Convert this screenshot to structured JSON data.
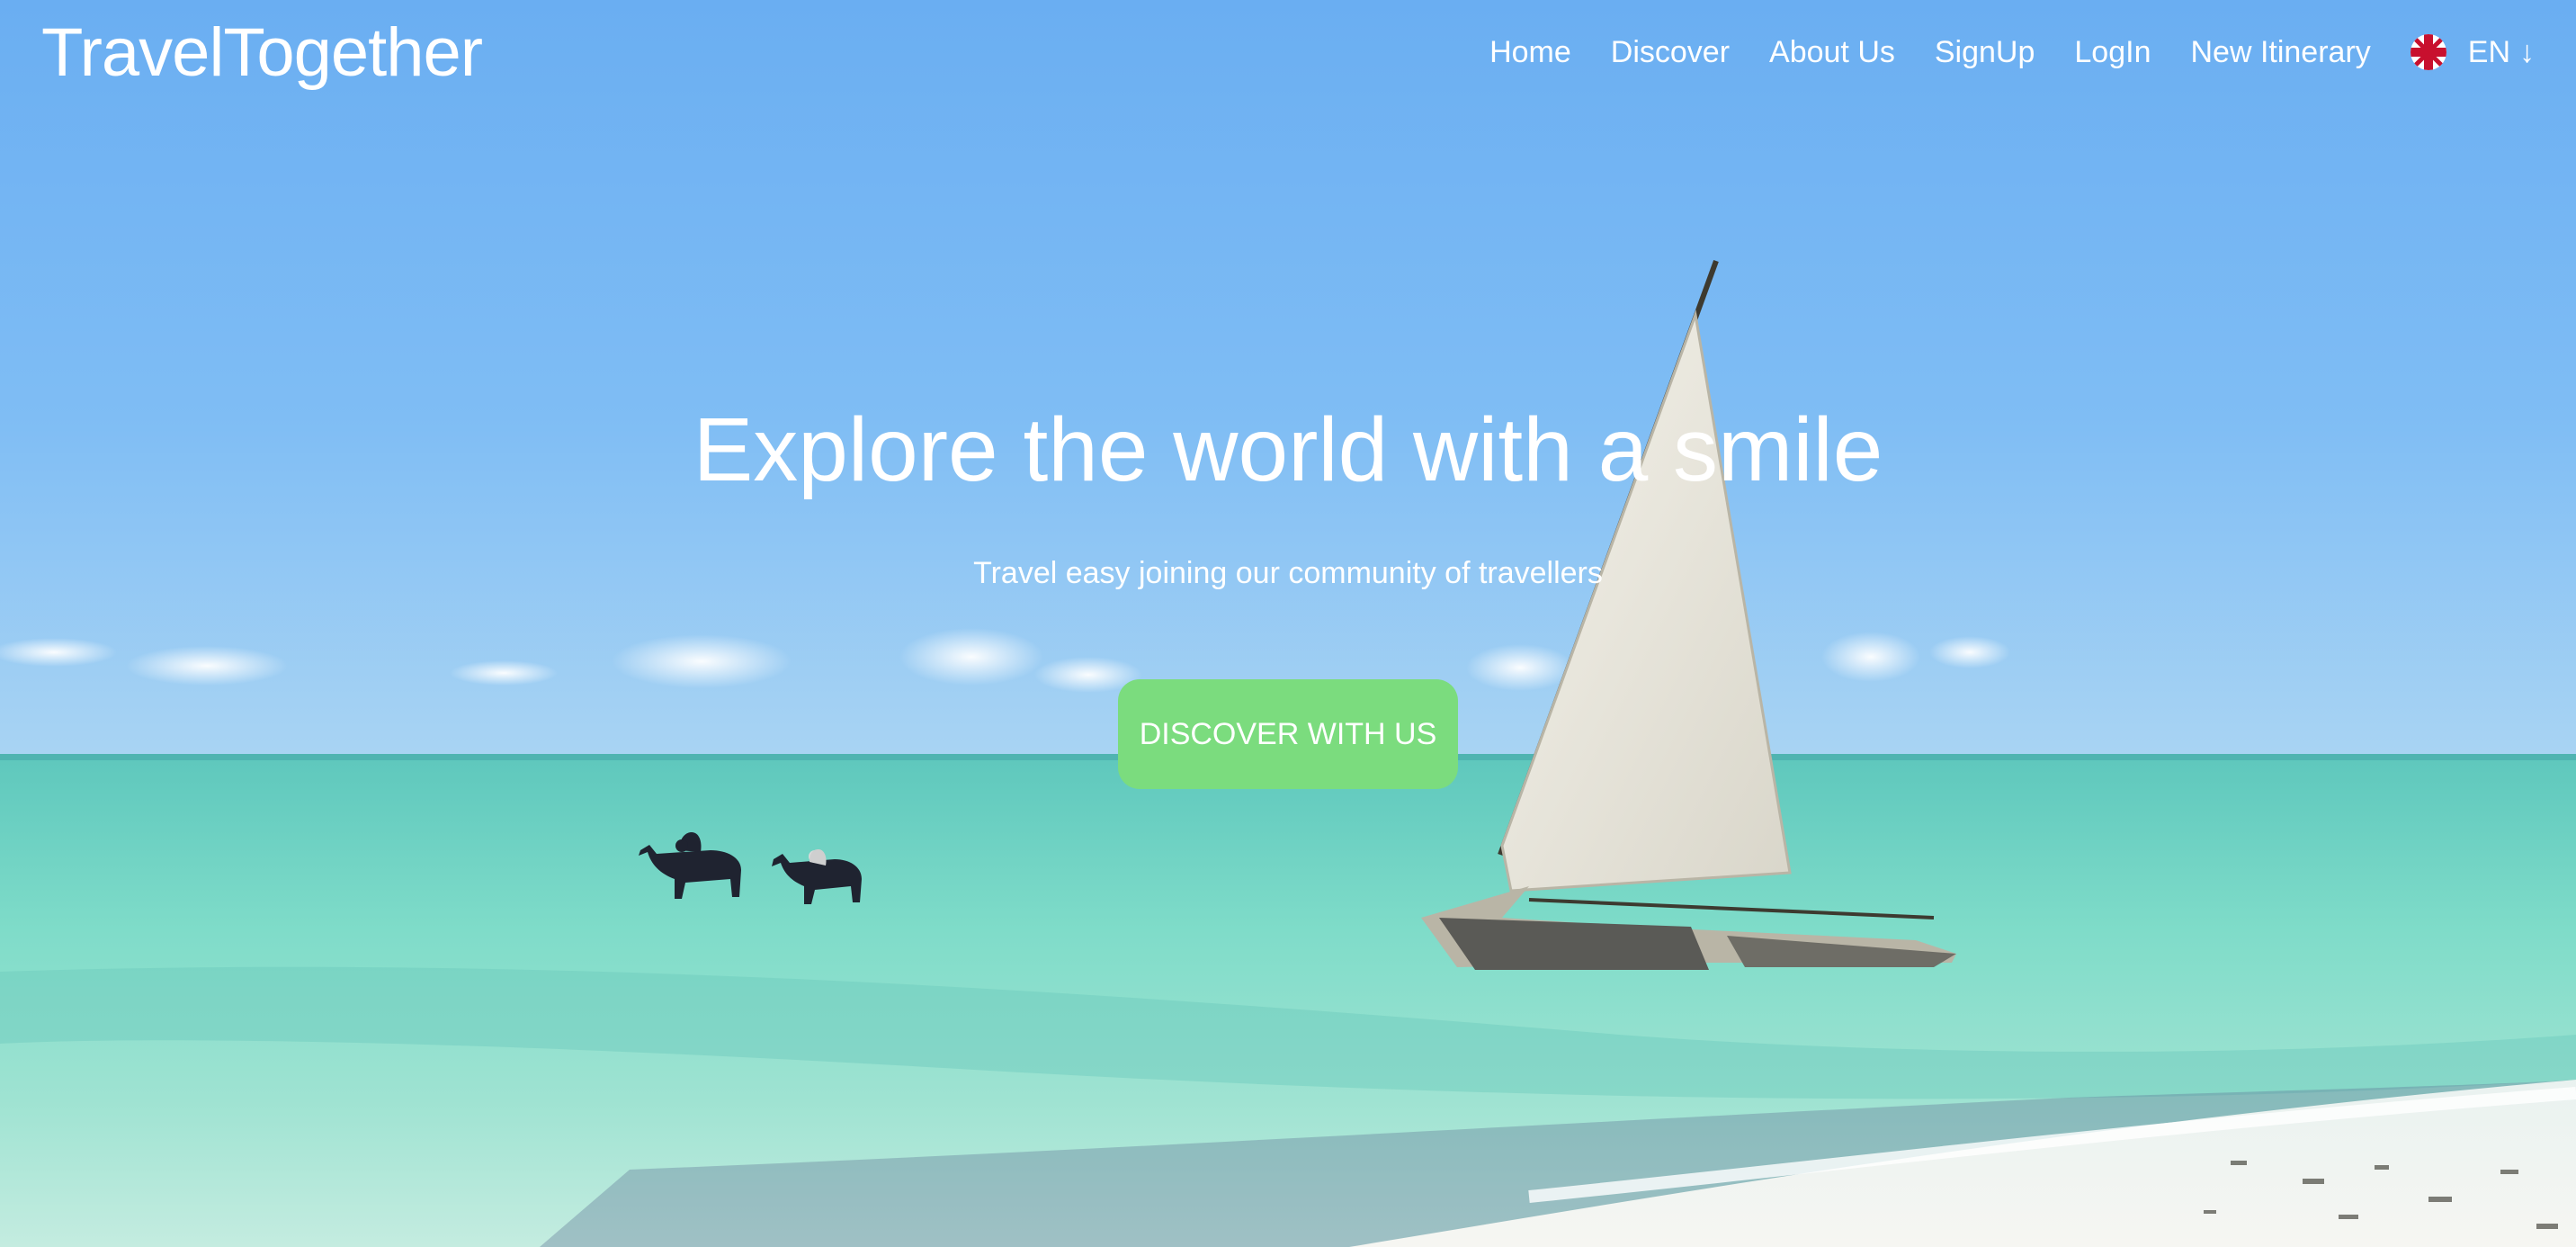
{
  "header": {
    "brand": "TravelTogether",
    "nav": [
      {
        "label": "Home"
      },
      {
        "label": "Discover"
      },
      {
        "label": "About Us"
      },
      {
        "label": "SignUp"
      },
      {
        "label": "LogIn"
      },
      {
        "label": "New Itinerary"
      }
    ],
    "language": {
      "code": "EN",
      "arrow": "↓",
      "flag_icon": "uk-flag-icon"
    }
  },
  "hero": {
    "title": "Explore the world with a smile",
    "subtitle": "Travel easy joining our community of travellers",
    "cta_label": "DISCOVER WITH US"
  },
  "colors": {
    "cta_green": "#7bdc7e",
    "sky_top": "#6aaef2",
    "sea": "#7fdcc9",
    "text": "#ffffff"
  }
}
